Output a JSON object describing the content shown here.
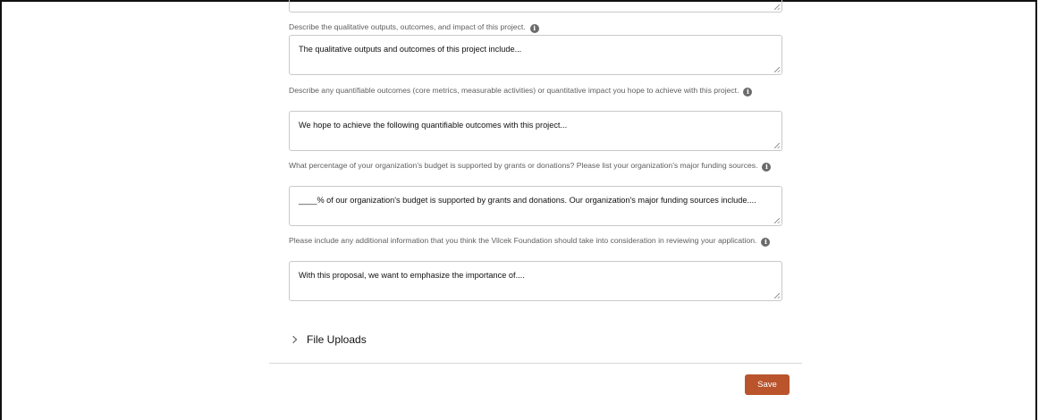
{
  "questions": [
    {
      "label": "Describe the qualitative outputs, outcomes, and impact of this project.",
      "value": "The qualitative outputs and outcomes of this project include..."
    },
    {
      "label": "Describe any quantifiable outcomes (core metrics, measurable activities) or quantitative impact you hope to achieve with this project.",
      "value": "We hope to achieve the following quantifiable outcomes with this project..."
    },
    {
      "label": "What percentage of your organization's budget is supported by grants or donations? Please list your organization's major funding sources.",
      "value": "____% of our organization's budget is supported by grants and donations. Our organization's major funding sources include...."
    },
    {
      "label": "Please include any additional information that you think the Vilcek Foundation should take into consideration in reviewing your application.",
      "value": "With this proposal, we want to emphasize the importance of...."
    }
  ],
  "info_glyph": "i",
  "section": {
    "file_uploads_label": "File Uploads"
  },
  "footer": {
    "save_label": "Save",
    "save_color": "#b9542d"
  },
  "icons": {
    "info": "info-circle-icon",
    "expand": "chevron-right-icon"
  }
}
